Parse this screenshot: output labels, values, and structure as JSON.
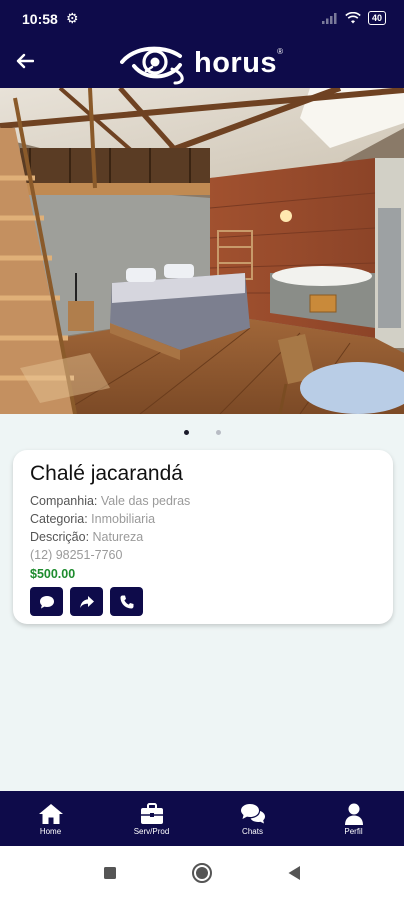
{
  "status_bar": {
    "time": "10:58",
    "battery": "40"
  },
  "header": {
    "logo_text": "horus",
    "logo_reg": "®"
  },
  "carousel": {
    "slide_count": 2,
    "active_index": 0
  },
  "listing": {
    "title": "Chalé jacarandá",
    "company_label": "Companhia: ",
    "company_value": "Vale das pedras",
    "category_label": "Categoria: ",
    "category_value": "Inmobiliaria",
    "description_label": "Descrição: ",
    "description_value": "Natureza",
    "phone": "(12) 98251-7760",
    "price": "$500.00"
  },
  "bottom_nav": {
    "items": [
      {
        "label": "Home",
        "icon": "home-icon"
      },
      {
        "label": "Serv/Prod",
        "icon": "briefcase-icon"
      },
      {
        "label": "Chats",
        "icon": "chats-icon"
      },
      {
        "label": "Perfil",
        "icon": "person-icon"
      }
    ]
  },
  "colors": {
    "brand_navy": "#0e0b4a",
    "price_green": "#1e8c2e",
    "page_background": "#eef5f5"
  }
}
